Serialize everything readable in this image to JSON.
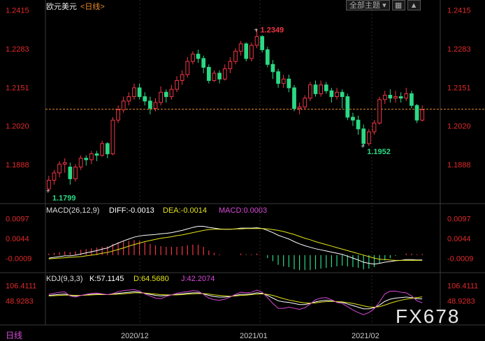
{
  "header": {
    "symbol": "欧元美元",
    "period": "<日线>",
    "theme_label": "全部主题",
    "dropdown_icon": "triangle-down-icon",
    "grid_icon": "grid-icon",
    "expand_icon": "triangle-up-icon"
  },
  "colors": {
    "up": "#f23645",
    "down": "#2bd985",
    "axis_text": "#e02a2a",
    "ref_line": "#e88a2c",
    "grid": "#2a2a2a",
    "macd_dif": "#ffffff",
    "macd_dea": "#e5e51a",
    "macd_hist": "#d94ad9",
    "kdj_k": "#ffffff",
    "kdj_d": "#e5e51a",
    "kdj_j": "#d94ad9"
  },
  "watermark": "FX678",
  "footer": {
    "period_label": "日线",
    "dates": [
      "2020/12",
      "2021/01",
      "2021/02"
    ]
  },
  "chart_data": [
    {
      "type": "candlestick",
      "ylim": [
        1.176,
        1.244
      ],
      "yticks": [
        "1.2415",
        "1.2283",
        "1.2151",
        "1.2020",
        "1.1888"
      ],
      "high_label": "1.2349",
      "low_label": "1.1799",
      "local_low_label": "1.1952",
      "ref_price": 1.2077,
      "candles": [
        [
          1.1805,
          1.1835,
          1.1799,
          1.185
        ],
        [
          1.1835,
          1.186,
          1.182,
          1.187
        ],
        [
          1.186,
          1.189,
          1.1845,
          1.19
        ],
        [
          1.189,
          1.1895,
          1.186,
          1.191
        ],
        [
          1.188,
          1.184,
          1.182,
          1.1895
        ],
        [
          1.184,
          1.188,
          1.183,
          1.189
        ],
        [
          1.188,
          1.191,
          1.187,
          1.192
        ],
        [
          1.191,
          1.1905,
          1.1885,
          1.192
        ],
        [
          1.1905,
          1.1925,
          1.189,
          1.1935
        ],
        [
          1.1925,
          1.192,
          1.19,
          1.1935
        ],
        [
          1.192,
          1.196,
          1.1915,
          1.197
        ],
        [
          1.196,
          1.1925,
          1.191,
          1.1965
        ],
        [
          1.1925,
          1.204,
          1.192,
          1.205
        ],
        [
          1.204,
          1.2075,
          1.203,
          1.209
        ],
        [
          1.2075,
          1.2105,
          1.2065,
          1.212
        ],
        [
          1.2105,
          1.212,
          1.209,
          1.2135
        ],
        [
          1.212,
          1.215,
          1.211,
          1.2165
        ],
        [
          1.215,
          1.212,
          1.211,
          1.2165
        ],
        [
          1.212,
          1.2105,
          1.209,
          1.2135
        ],
        [
          1.2105,
          1.208,
          1.206,
          1.212
        ],
        [
          1.208,
          1.21,
          1.207,
          1.2115
        ],
        [
          1.21,
          1.2135,
          1.209,
          1.2155
        ],
        [
          1.2135,
          1.212,
          1.21,
          1.2145
        ],
        [
          1.212,
          1.2145,
          1.211,
          1.216
        ],
        [
          1.2145,
          1.2175,
          1.2135,
          1.219
        ],
        [
          1.2175,
          1.2195,
          1.216,
          1.221
        ],
        [
          1.2195,
          1.224,
          1.2185,
          1.2255
        ],
        [
          1.224,
          1.2265,
          1.223,
          1.2275
        ],
        [
          1.2265,
          1.225,
          1.2235,
          1.228
        ],
        [
          1.225,
          1.222,
          1.22,
          1.226
        ],
        [
          1.222,
          1.2175,
          1.2165,
          1.223
        ],
        [
          1.2175,
          1.22,
          1.217,
          1.221
        ],
        [
          1.22,
          1.218,
          1.2165,
          1.221
        ],
        [
          1.218,
          1.2215,
          1.2175,
          1.223
        ],
        [
          1.2215,
          1.224,
          1.22,
          1.2255
        ],
        [
          1.224,
          1.2275,
          1.223,
          1.2285
        ],
        [
          1.2275,
          1.23,
          1.226,
          1.231
        ],
        [
          1.23,
          1.225,
          1.224,
          1.2305
        ],
        [
          1.225,
          1.2295,
          1.224,
          1.2305
        ],
        [
          1.2295,
          1.2325,
          1.2285,
          1.2349
        ],
        [
          1.2325,
          1.228,
          1.227,
          1.233
        ],
        [
          1.228,
          1.223,
          1.222,
          1.229
        ],
        [
          1.223,
          1.2205,
          1.218,
          1.2245
        ],
        [
          1.2205,
          1.2165,
          1.215,
          1.2215
        ],
        [
          1.2165,
          1.218,
          1.215,
          1.2195
        ],
        [
          1.218,
          1.215,
          1.2135,
          1.2195
        ],
        [
          1.215,
          1.208,
          1.207,
          1.216
        ],
        [
          1.208,
          1.2085,
          1.206,
          1.21
        ],
        [
          1.2085,
          1.2115,
          1.2075,
          1.2125
        ],
        [
          1.2115,
          1.216,
          1.2105,
          1.217
        ],
        [
          1.216,
          1.213,
          1.212,
          1.2175
        ],
        [
          1.213,
          1.216,
          1.212,
          1.2175
        ],
        [
          1.216,
          1.214,
          1.213,
          1.217
        ],
        [
          1.214,
          1.212,
          1.21,
          1.215
        ],
        [
          1.212,
          1.2135,
          1.211,
          1.215
        ],
        [
          1.2135,
          1.212,
          1.208,
          1.2145
        ],
        [
          1.212,
          1.205,
          1.204,
          1.213
        ],
        [
          1.205,
          1.204,
          1.202,
          1.2065
        ],
        [
          1.204,
          1.201,
          1.199,
          1.2055
        ],
        [
          1.201,
          1.196,
          1.1952,
          1.2025
        ],
        [
          1.196,
          1.2,
          1.1952,
          1.201
        ],
        [
          1.2,
          1.203,
          1.199,
          1.204
        ],
        [
          1.203,
          1.211,
          1.2025,
          1.212
        ],
        [
          1.211,
          1.2125,
          1.2095,
          1.214
        ],
        [
          1.2125,
          1.2115,
          1.21,
          1.2145
        ],
        [
          1.2115,
          1.212,
          1.21,
          1.214
        ],
        [
          1.212,
          1.2115,
          1.21,
          1.2135
        ],
        [
          1.2115,
          1.213,
          1.2105,
          1.215
        ],
        [
          1.213,
          1.209,
          1.208,
          1.214
        ],
        [
          1.209,
          1.204,
          1.203,
          1.2095
        ],
        [
          1.204,
          1.2075,
          1.2035,
          1.209
        ]
      ]
    },
    {
      "type": "line",
      "title": "MACD(26,12,9)",
      "legend": [
        "DIFF:-0.0013",
        "DEA:-0.0014",
        "MACD:0.0003"
      ],
      "ylim": [
        -0.0045,
        0.013
      ],
      "yticks": [
        "0.0097",
        "0.0044",
        "-0.0009"
      ],
      "series": [
        {
          "name": "DIFF",
          "values": [
            -0.0008,
            -0.0006,
            -0.0004,
            -0.0002,
            -0.0002,
            0.0,
            0.0003,
            0.0006,
            0.0009,
            0.0012,
            0.0016,
            0.0019,
            0.0026,
            0.0032,
            0.0038,
            0.0043,
            0.0048,
            0.0051,
            0.0053,
            0.0054,
            0.0055,
            0.0057,
            0.0058,
            0.006,
            0.0063,
            0.0066,
            0.007,
            0.0074,
            0.0077,
            0.0077,
            0.0074,
            0.0072,
            0.007,
            0.0069,
            0.0069,
            0.007,
            0.0072,
            0.0072,
            0.0072,
            0.0073,
            0.0071,
            0.0066,
            0.006,
            0.0053,
            0.0048,
            0.0043,
            0.0036,
            0.003,
            0.0025,
            0.0021,
            0.0017,
            0.0014,
            0.0011,
            0.0008,
            0.0005,
            0.0002,
            -0.0003,
            -0.0008,
            -0.0013,
            -0.0019,
            -0.0022,
            -0.0024,
            -0.0022,
            -0.0019,
            -0.0017,
            -0.0015,
            -0.0014,
            -0.0012,
            -0.0012,
            -0.0013,
            -0.0013
          ]
        },
        {
          "name": "DEA",
          "values": [
            -0.001,
            -0.0009,
            -0.0008,
            -0.0007,
            -0.0006,
            -0.0005,
            -0.0004,
            -0.0002,
            0.0,
            0.0002,
            0.0005,
            0.0007,
            0.0011,
            0.0015,
            0.0019,
            0.0024,
            0.0028,
            0.0032,
            0.0036,
            0.0039,
            0.0042,
            0.0045,
            0.0047,
            0.0049,
            0.0052,
            0.0054,
            0.0057,
            0.006,
            0.0063,
            0.0066,
            0.0068,
            0.0069,
            0.0069,
            0.0069,
            0.0069,
            0.007,
            0.007,
            0.0071,
            0.0071,
            0.0071,
            0.0071,
            0.007,
            0.0068,
            0.0066,
            0.0063,
            0.0059,
            0.0055,
            0.005,
            0.0045,
            0.0041,
            0.0036,
            0.0032,
            0.0028,
            0.0024,
            0.002,
            0.0016,
            0.0012,
            0.0008,
            0.0004,
            0.0,
            -0.0004,
            -0.0008,
            -0.0011,
            -0.0012,
            -0.0013,
            -0.0014,
            -0.0014,
            -0.0014,
            -0.0014,
            -0.0014,
            -0.0014
          ]
        }
      ],
      "histogram": [
        0.0004,
        0.0006,
        0.0008,
        0.001,
        0.0008,
        0.001,
        0.0014,
        0.0016,
        0.0018,
        0.002,
        0.0022,
        0.0024,
        0.003,
        0.0034,
        0.0038,
        0.0038,
        0.004,
        0.0038,
        0.0034,
        0.003,
        0.0026,
        0.0024,
        0.0022,
        0.0022,
        0.0022,
        0.0024,
        0.0026,
        0.0028,
        0.0028,
        0.0022,
        0.0012,
        0.0006,
        0.0002,
        0.0,
        0.0,
        0.0,
        0.0004,
        0.0002,
        0.0002,
        0.0004,
        0.0,
        -0.0008,
        -0.0016,
        -0.0026,
        -0.003,
        -0.0032,
        -0.0038,
        -0.004,
        -0.004,
        -0.004,
        -0.0038,
        -0.0036,
        -0.0034,
        -0.0032,
        -0.003,
        -0.0028,
        -0.003,
        -0.0032,
        -0.0034,
        -0.0038,
        -0.0036,
        -0.0032,
        -0.0022,
        -0.0014,
        -0.0008,
        -0.0002,
        0.0,
        0.0004,
        0.0004,
        0.0002,
        0.0003
      ]
    },
    {
      "type": "line",
      "title": "KDJ(9,3,3)",
      "legend": [
        "K:57.1145",
        "D:64.5680",
        "J:42.2074"
      ],
      "ylim": [
        -30,
        150
      ],
      "yticks": [
        "106.4111",
        "48.9283"
      ],
      "series": [
        {
          "name": "K",
          "values": [
            70,
            72,
            74,
            75,
            70,
            68,
            70,
            72,
            74,
            75,
            74,
            73,
            75,
            78,
            80,
            82,
            84,
            82,
            78,
            74,
            70,
            68,
            70,
            72,
            74,
            76,
            78,
            80,
            80,
            76,
            70,
            66,
            64,
            64,
            66,
            70,
            74,
            74,
            76,
            80,
            78,
            70,
            60,
            50,
            46,
            44,
            40,
            36,
            36,
            40,
            46,
            50,
            52,
            50,
            46,
            44,
            38,
            32,
            26,
            20,
            20,
            24,
            34,
            48,
            56,
            60,
            62,
            64,
            62,
            58,
            57
          ]
        },
        {
          "name": "D",
          "values": [
            68,
            69,
            70,
            71,
            71,
            70,
            70,
            71,
            72,
            73,
            73,
            73,
            74,
            75,
            76,
            78,
            80,
            80,
            79,
            77,
            75,
            73,
            72,
            72,
            72,
            73,
            75,
            76,
            77,
            77,
            75,
            72,
            70,
            68,
            67,
            68,
            70,
            71,
            73,
            75,
            76,
            74,
            70,
            64,
            58,
            53,
            49,
            45,
            42,
            41,
            42,
            45,
            47,
            48,
            47,
            46,
            43,
            40,
            36,
            31,
            27,
            26,
            28,
            34,
            41,
            47,
            52,
            56,
            59,
            62,
            64.5
          ]
        },
        {
          "name": "J",
          "values": [
            74,
            78,
            82,
            83,
            68,
            64,
            70,
            74,
            78,
            79,
            76,
            73,
            77,
            84,
            88,
            90,
            92,
            86,
            76,
            68,
            60,
            58,
            66,
            72,
            78,
            82,
            84,
            88,
            86,
            74,
            60,
            54,
            52,
            56,
            64,
            74,
            82,
            80,
            82,
            90,
            82,
            62,
            40,
            22,
            22,
            26,
            22,
            18,
            24,
            38,
            54,
            60,
            62,
            54,
            44,
            40,
            28,
            16,
            6,
            -2,
            6,
            20,
            46,
            76,
            86,
            86,
            82,
            80,
            68,
            50,
            42.2
          ]
        }
      ]
    }
  ]
}
